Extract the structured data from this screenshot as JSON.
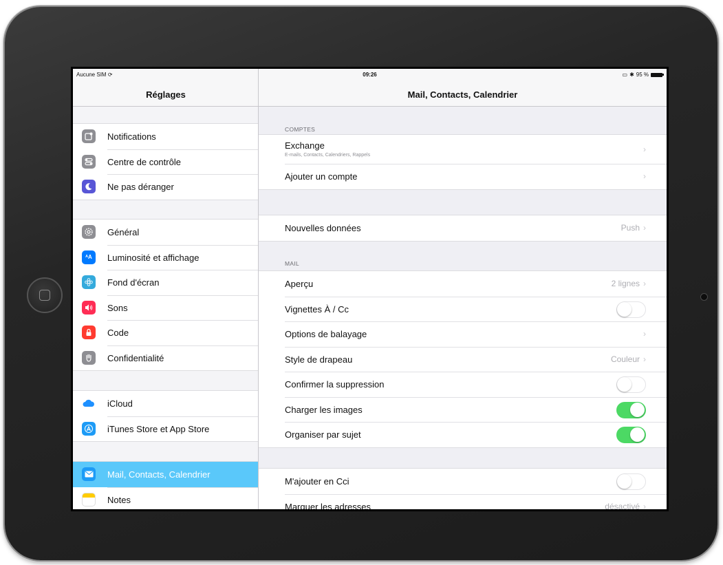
{
  "status_bar": {
    "carrier": "Aucune SIM",
    "time": "09:26",
    "battery": "95 %"
  },
  "sidebar": {
    "title": "Réglages",
    "groups": [
      [
        {
          "label": "Notifications",
          "icon": "notifications-icon",
          "color": "#8e8e93"
        },
        {
          "label": "Centre de contrôle",
          "icon": "control-center-icon",
          "color": "#8e8e93"
        },
        {
          "label": "Ne pas déranger",
          "icon": "moon-icon",
          "color": "#5856d6"
        }
      ],
      [
        {
          "label": "Général",
          "icon": "gear-icon",
          "color": "#8e8e93"
        },
        {
          "label": "Luminosité et affichage",
          "icon": "brightness-icon",
          "color": "#007aff"
        },
        {
          "label": "Fond d'écran",
          "icon": "wallpaper-icon",
          "color": "#34aadc"
        },
        {
          "label": "Sons",
          "icon": "speaker-icon",
          "color": "#ff2d55"
        },
        {
          "label": "Code",
          "icon": "lock-icon",
          "color": "#ff3b30"
        },
        {
          "label": "Confidentialité",
          "icon": "hand-icon",
          "color": "#8e8e93"
        }
      ],
      [
        {
          "label": "iCloud",
          "icon": "cloud-icon",
          "color": "#1e90ff"
        },
        {
          "label": "iTunes Store et App Store",
          "icon": "app-store-icon",
          "color": "#1d9bf6"
        }
      ],
      [
        {
          "label": "Mail, Contacts, Calendrier",
          "icon": "mail-icon",
          "color": "#1d9bf6",
          "selected": true
        },
        {
          "label": "Notes",
          "icon": "notes-icon",
          "color": "#ffcc00"
        }
      ]
    ]
  },
  "main": {
    "title": "Mail, Contacts, Calendrier",
    "accounts_section": "COMPTES",
    "mail_section": "MAIL",
    "rows": {
      "exchange": {
        "label": "Exchange",
        "sub": "E-mails, Contacts, Calendriers, Rappels"
      },
      "add_account": {
        "label": "Ajouter un compte"
      },
      "fetch": {
        "label": "Nouvelles données",
        "value": "Push"
      },
      "preview": {
        "label": "Aperçu",
        "value": "2 lignes"
      },
      "to_cc": {
        "label": "Vignettes À / Cc",
        "on": false
      },
      "swipe": {
        "label": "Options de balayage"
      },
      "flag": {
        "label": "Style de drapeau",
        "value": "Couleur"
      },
      "confirm_delete": {
        "label": "Confirmer la suppression",
        "on": false
      },
      "load_images": {
        "label": "Charger les images",
        "on": true
      },
      "thread": {
        "label": "Organiser par sujet",
        "on": true
      },
      "bcc": {
        "label": "M'ajouter en Cci",
        "on": false
      },
      "mark_addresses": {
        "label": "Marquer les adresses",
        "value": "désactivé"
      }
    },
    "chevron": "›"
  },
  "colors": {
    "accent": "#5ac8fa",
    "toggle_on": "#4cd964"
  }
}
